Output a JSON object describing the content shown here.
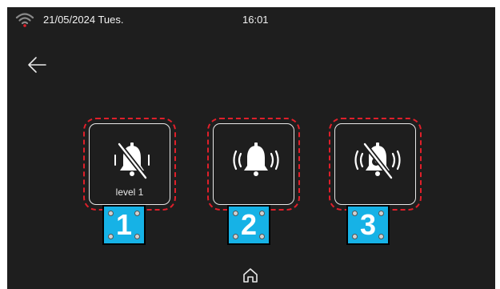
{
  "status": {
    "date": "21/05/2024 Tues.",
    "time": "16:01"
  },
  "icons": {
    "wifi": "wifi-signal-icon",
    "back": "back-arrow-icon",
    "home": "home-icon"
  },
  "colors": {
    "background": "#1e1e1e",
    "selection_dash": "#e01f2a",
    "tag": "#16b2e6",
    "wifi_active": "#e01f2a"
  },
  "modes": [
    {
      "icon": "bell-muted-icon",
      "label": "level 1",
      "tag": "1"
    },
    {
      "icon": "bell-ringing-icon",
      "label": "",
      "tag": "2"
    },
    {
      "icon": "bell-muted-night-icon",
      "label": "",
      "tag": "3"
    }
  ]
}
